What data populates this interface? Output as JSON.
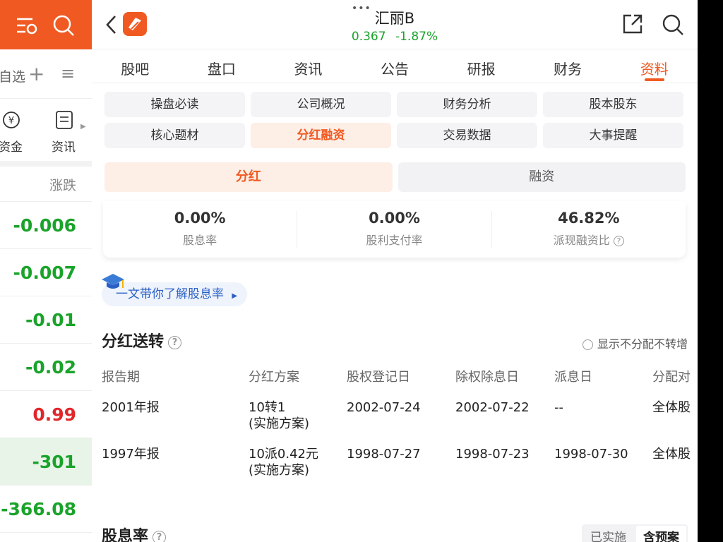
{
  "left_panel": {
    "row2_label": "自选",
    "row3": {
      "fund_label": "资金",
      "news_label": "资讯"
    },
    "header": "涨跌",
    "values": [
      {
        "text": "-0.006",
        "color": "green"
      },
      {
        "text": "-0.007",
        "color": "green"
      },
      {
        "text": "-0.01",
        "color": "green"
      },
      {
        "text": "-0.02",
        "color": "green"
      },
      {
        "text": "0.99",
        "color": "red"
      },
      {
        "text": "-301",
        "color": "green"
      },
      {
        "text": "-366.08",
        "color": "green"
      }
    ]
  },
  "header": {
    "title": "汇丽B",
    "price": "0.367",
    "change": "-1.87%"
  },
  "tabs": [
    "股吧",
    "盘口",
    "资讯",
    "公告",
    "研报",
    "财务",
    "资料"
  ],
  "active_tab": "资料",
  "grid": [
    "操盘必读",
    "公司概况",
    "财务分析",
    "股本股东",
    "核心题材",
    "分红融资",
    "交易数据",
    "大事提醒"
  ],
  "active_grid": "分红融资",
  "segments": [
    "分红",
    "融资"
  ],
  "active_segment": "分红",
  "stats": [
    {
      "value": "0.00%",
      "label": "股息率"
    },
    {
      "value": "0.00%",
      "label": "股利支付率"
    },
    {
      "value": "46.82%",
      "label": "派现融资比"
    }
  ],
  "learn_link": "一文带你了解股息率",
  "section1": {
    "title": "分红送转",
    "toggle_label": "显示不分配不转增",
    "columns": [
      "报告期",
      "分红方案",
      "股权登记日",
      "除权除息日",
      "派息日",
      "分配对"
    ],
    "rows": [
      {
        "period": "2001年报",
        "plan": "10转1",
        "plan_note": "(实施方案)",
        "record_date": "2002-07-24",
        "ex_date": "2002-07-22",
        "pay_date": "--",
        "target": "全体股"
      },
      {
        "period": "1997年报",
        "plan": "10派0.42元",
        "plan_note": "(实施方案)",
        "record_date": "1998-07-27",
        "ex_date": "1998-07-23",
        "pay_date": "1998-07-30",
        "target": "全体股"
      }
    ]
  },
  "section2": {
    "title": "股息率",
    "options": [
      "已实施",
      "含预案"
    ],
    "active_option": "含预案"
  },
  "colors": {
    "accent": "#f05a22",
    "up": "#e0272a",
    "down": "#1aa32a"
  }
}
